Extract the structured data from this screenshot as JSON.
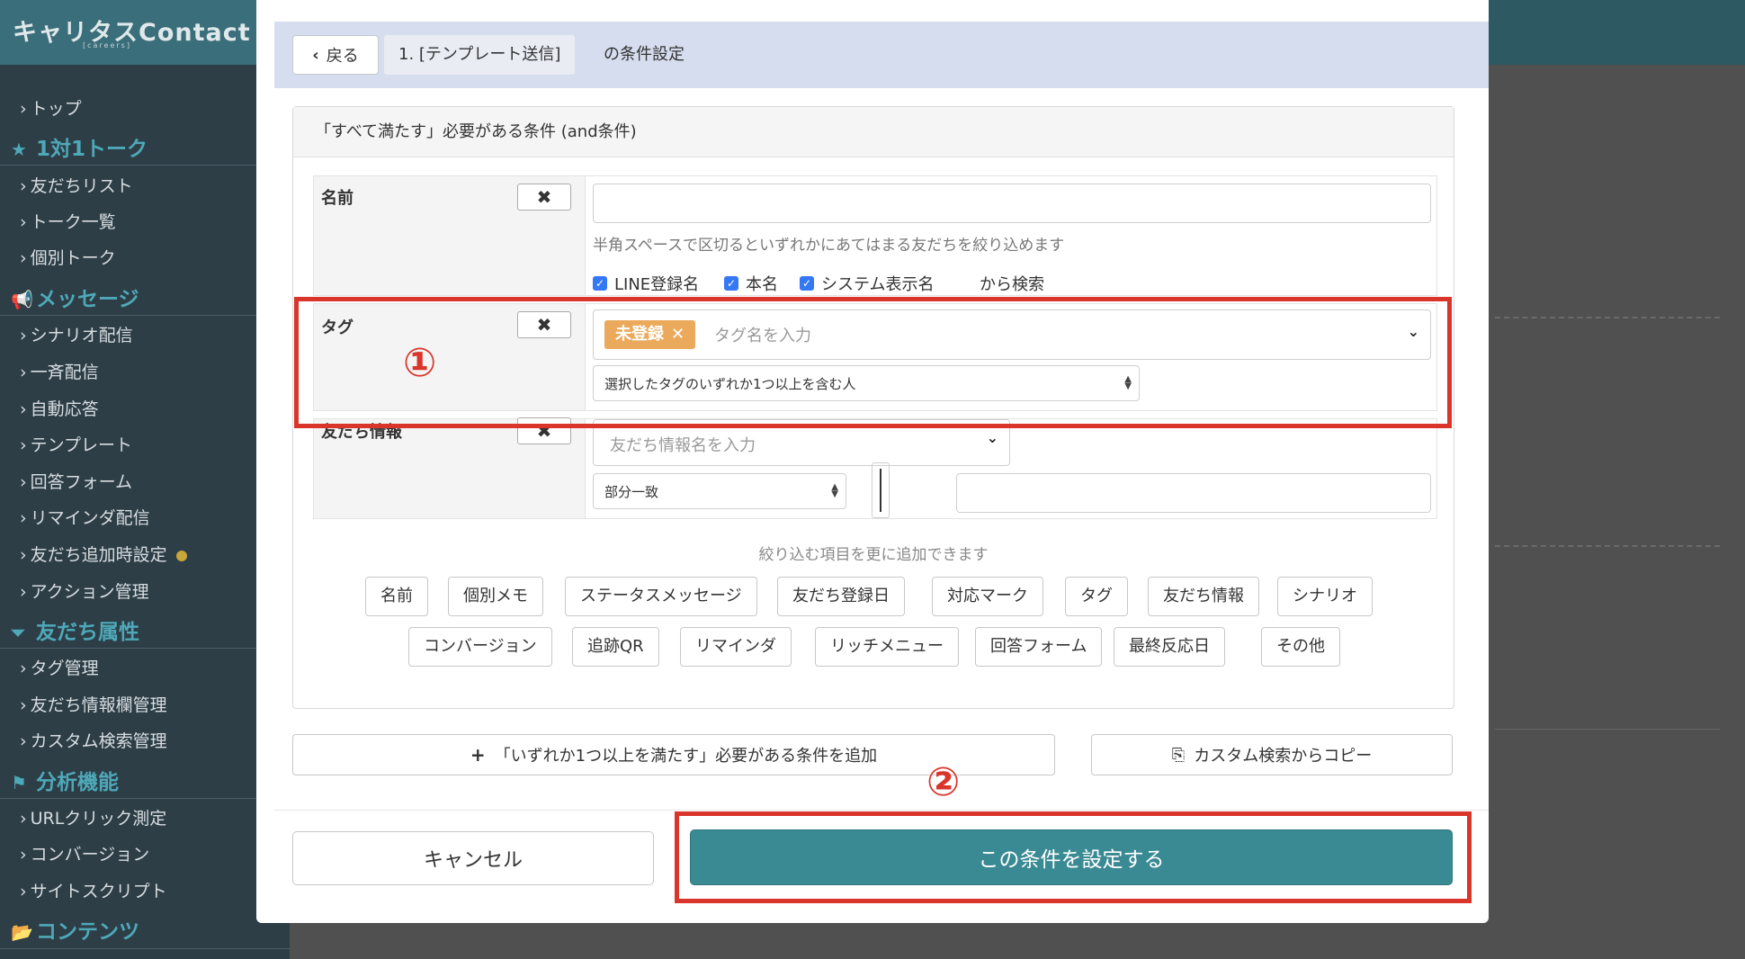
{
  "sidebar": {
    "logo": "キャリタスContact",
    "logo_sub": "[careers]",
    "items": [
      {
        "label": "トップ"
      },
      {
        "section": "1対1トーク",
        "icon": "★"
      },
      {
        "label": "友だちリスト"
      },
      {
        "label": "トーク一覧"
      },
      {
        "label": "個別トーク"
      },
      {
        "section": "メッセージ",
        "icon": "📢"
      },
      {
        "label": "シナリオ配信"
      },
      {
        "label": "一斉配信"
      },
      {
        "label": "自動応答"
      },
      {
        "label": "テンプレート"
      },
      {
        "label": "回答フォーム"
      },
      {
        "label": "リマインダ配信"
      },
      {
        "label": "友だち追加時設定"
      },
      {
        "label": "アクション管理"
      },
      {
        "section": "友だち属性",
        "icon": "⏷"
      },
      {
        "label": "タグ管理"
      },
      {
        "label": "友だち情報欄管理"
      },
      {
        "label": "カスタム検索管理"
      },
      {
        "section": "分析機能",
        "icon": "⚑"
      },
      {
        "label": "URLクリック測定"
      },
      {
        "label": "コンバージョン"
      },
      {
        "label": "サイトスクリプト"
      },
      {
        "section": "コンテンツ",
        "icon": "📂"
      }
    ]
  },
  "modal": {
    "back_label": "戻る",
    "crumb": "1. [テンプレート送信]",
    "crumb_suffix": "の条件設定",
    "panel_title": "「すべて満たす」必要がある条件 (and条件)",
    "name_row": {
      "label": "名前",
      "remove": "✖",
      "help": "半角スペースで区切るといずれかにあてはまる友だちを絞り込めます",
      "checkboxes": [
        "LINE登録名",
        "本名",
        "システム表示名"
      ],
      "search_suffix": "から検索"
    },
    "tag_row": {
      "label": "タグ",
      "remove": "✖",
      "chip": "未登録",
      "chip_x": "✕",
      "placeholder": "タグ名を入力",
      "match_mode": "選択したタグのいずれか1つ以上を含む人"
    },
    "friend_row": {
      "label": "友だち情報",
      "remove": "✖",
      "placeholder": "友だち情報名を入力",
      "match": "部分一致"
    },
    "add_hint": "絞り込む項目を更に追加できます",
    "filter_buttons_row1": [
      "名前",
      "個別メモ",
      "ステータスメッセージ",
      "友だち登録日",
      "対応マーク",
      "タグ",
      "友だち情報",
      "シナリオ"
    ],
    "filter_buttons_row2": [
      "コンバージョン",
      "追跡QR",
      "リマインダ",
      "リッチメニュー",
      "回答フォーム",
      "最終反応日",
      "その他"
    ],
    "add_or_condition": "「いずれか1つ以上を満たす」必要がある条件を追加",
    "copy_custom": "カスタム検索からコピー",
    "cancel": "キャンセル",
    "submit": "この条件を設定する"
  },
  "annotations": {
    "one": "①",
    "two": "②",
    "color": "#d9352b"
  },
  "colors": {
    "accent": "#3a8a93",
    "tag_chip": "#eba95c",
    "sidebar": "#2d3e47"
  }
}
